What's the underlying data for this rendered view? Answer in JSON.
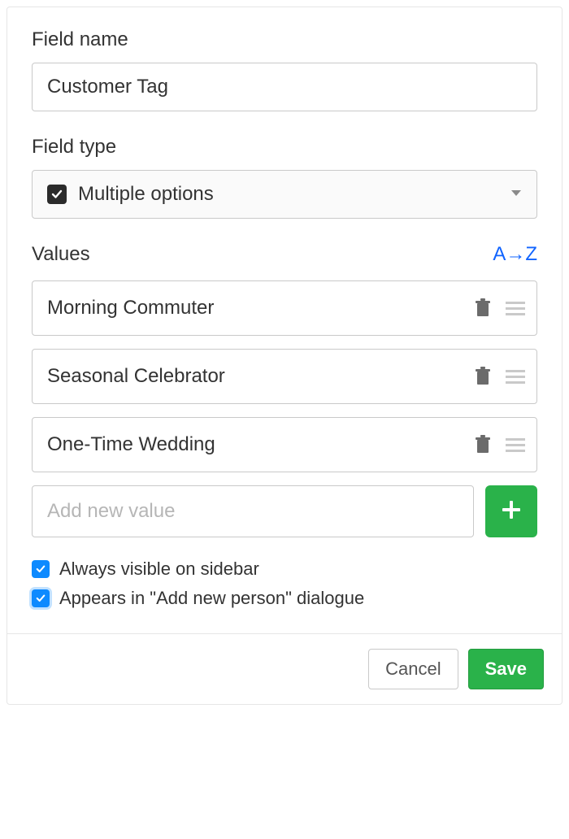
{
  "field_name": {
    "label": "Field name",
    "value": "Customer Tag"
  },
  "field_type": {
    "label": "Field type",
    "selected": "Multiple options"
  },
  "values_section": {
    "label": "Values",
    "sort_label": "A→Z",
    "items": [
      {
        "text": "Morning Commuter"
      },
      {
        "text": "Seasonal Celebrator"
      },
      {
        "text": "One-Time Wedding"
      }
    ],
    "add_placeholder": "Add new value"
  },
  "checkboxes": {
    "sidebar": {
      "label": "Always visible on sidebar",
      "checked": true
    },
    "add_dialog": {
      "label": "Appears in \"Add new person\" dialogue",
      "checked": true
    }
  },
  "footer": {
    "cancel": "Cancel",
    "save": "Save"
  }
}
